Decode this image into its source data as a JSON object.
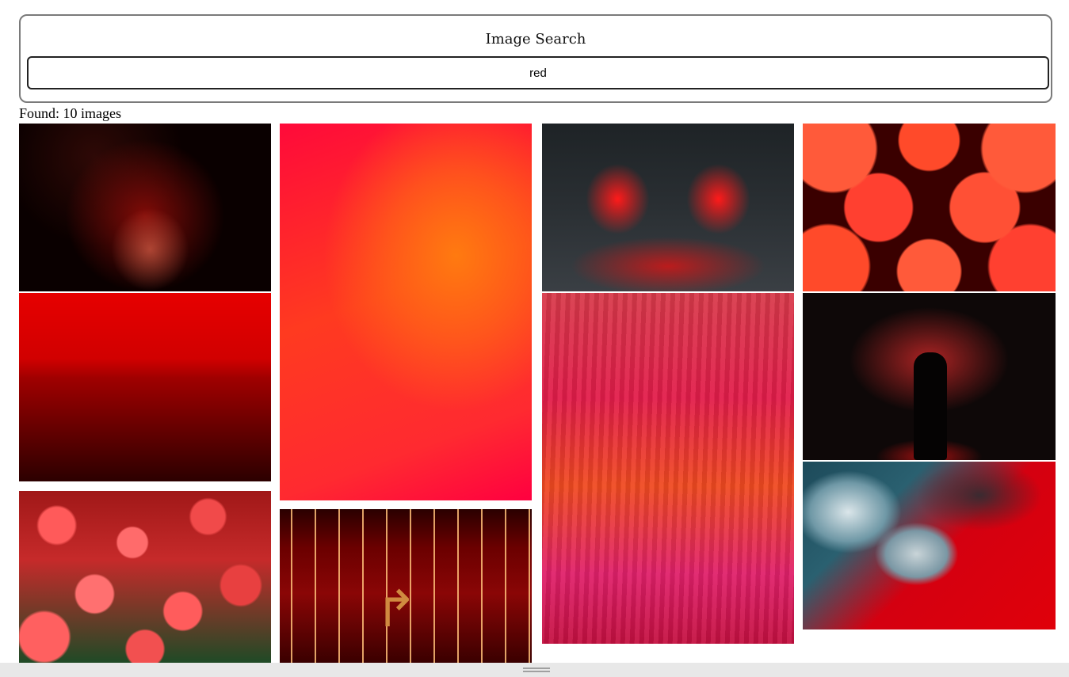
{
  "search": {
    "title": "Image Search",
    "query": "red"
  },
  "results": {
    "count_text": "Found: 10 images",
    "images": [
      {
        "subject": "red fireworks at night"
      },
      {
        "subject": "red sky over sea"
      },
      {
        "subject": "red flowers field"
      },
      {
        "subject": "red to orange gradient"
      },
      {
        "subject": "red neon lights corridor with arrow sign"
      },
      {
        "subject": "red reflections in puddle"
      },
      {
        "subject": "red and pink abstract paint strokes"
      },
      {
        "subject": "red chinese lanterns"
      },
      {
        "subject": "silhouette in red smoke"
      },
      {
        "subject": "red and blue marbled abstract"
      }
    ]
  }
}
